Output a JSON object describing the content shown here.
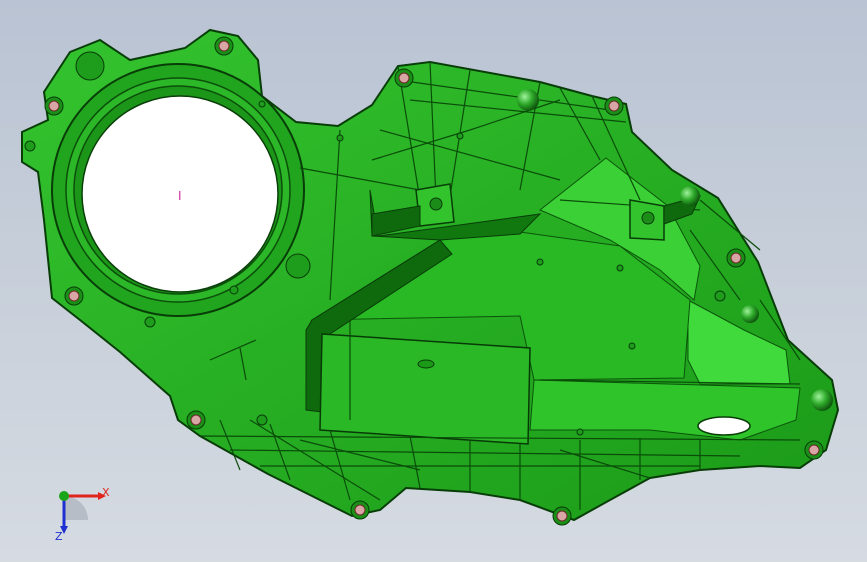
{
  "viewport": {
    "background_top": "#b9c3d3",
    "background_bottom": "#d6dbe2"
  },
  "model": {
    "part": "door-module-carrier-plate",
    "body_color": "#1fa51c",
    "body_light": "#3fd63a",
    "body_dark": "#0c5c0b",
    "edge_color": "#083d08",
    "boss_color": "#d9a6a6",
    "cursor_marker": "I"
  },
  "triad": {
    "x_label": "X",
    "z_label": "Z",
    "x_color": "#e0241b",
    "z_color": "#1f2fd0",
    "y_color": "#1aa51a"
  }
}
